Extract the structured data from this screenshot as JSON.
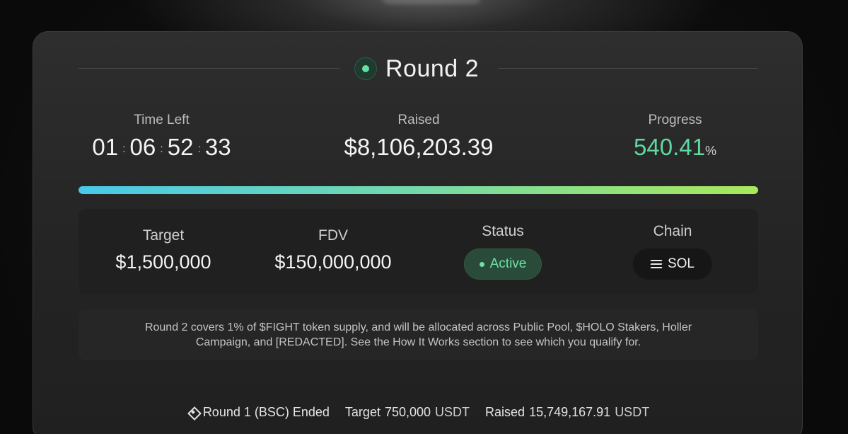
{
  "round": {
    "title": "Round 2"
  },
  "stats": {
    "time_left_label": "Time Left",
    "time": {
      "hours": "01",
      "minutes": "06",
      "seconds": "52",
      "frames": "33",
      "separator": ":"
    },
    "raised_label": "Raised",
    "raised_value": "$8,106,203.39",
    "progress_label": "Progress",
    "progress_value": "540.41",
    "progress_unit": "%"
  },
  "progress_bar": {
    "fill_fraction": 1.0,
    "colors": [
      "#48c9e8",
      "#6fd8b0",
      "#a9e85a"
    ]
  },
  "info": {
    "target_label": "Target",
    "target_value": "$1,500,000",
    "fdv_label": "FDV",
    "fdv_value": "$150,000,000",
    "status_label": "Status",
    "status_value": "Active",
    "chain_label": "Chain",
    "chain_value": "SOL",
    "chain_icon": "solana-icon"
  },
  "description": "Round 2 covers 1% of $FIGHT token supply, and will be allocated across Public Pool, $HOLO Stakers, Holler Campaign, and [REDACTED]. See the How It Works section to see which you qualify for.",
  "footer": {
    "round1_label": "Round 1 (BSC) Ended",
    "round1_icon": "bnb-icon",
    "target_label": "Target",
    "target_value": "750,000",
    "target_unit": "USDT",
    "raised_label": "Raised",
    "raised_value": "15,749,167.91",
    "raised_unit": "USDT"
  },
  "colors": {
    "accent_green": "#5fd8a0",
    "card_bg": "#262626",
    "status_bg": "#2a4a3a"
  }
}
